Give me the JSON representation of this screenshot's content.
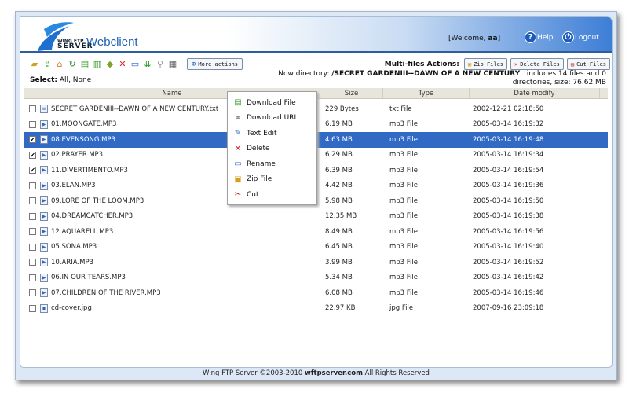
{
  "header": {
    "logo_small": "WING FTP",
    "logo_big": "SERVER",
    "title": "Webclient",
    "welcome_prefix": "[Welcome, ",
    "user": "aa",
    "welcome_suffix": "]",
    "help": "Help",
    "logout": "Logout"
  },
  "toolbar": {
    "icons": [
      "new-folder-icon",
      "upload-icon",
      "home-icon",
      "refresh-icon",
      "download-icon",
      "copy-icon",
      "move-icon",
      "delete-icon",
      "rename-icon",
      "sort-icon",
      "search-icon",
      "view-icon"
    ],
    "more_actions": "More actions"
  },
  "select": {
    "label": "Select:",
    "all": "All",
    "sep": ", ",
    "none": "None"
  },
  "multi": {
    "label": "Multi-files Actions:",
    "zip": "Zip Files",
    "delete": "Delete Files",
    "cut": "Cut Files"
  },
  "dir": {
    "prefix": "Now directory: ",
    "path": "/SECRET GARDENIII--DAWN OF A NEW CENTURY",
    "info1": "includes 14 files and 0",
    "info2": "directories, size: 76.62 MB"
  },
  "columns": {
    "name": "Name",
    "size": "Size",
    "type": "Type",
    "date": "Date modify"
  },
  "files": [
    {
      "name": "SECRET GARDENIII--DAWN OF A NEW CENTURY.txt",
      "size": "229 Bytes",
      "type": "txt File",
      "date": "2002-12-21 02:18:50",
      "checked": false,
      "selected": false
    },
    {
      "name": "01.MOONGATE.MP3",
      "size": "6.19 MB",
      "type": "mp3 File",
      "date": "2005-03-14 16:19:32",
      "checked": false,
      "selected": false
    },
    {
      "name": "08.EVENSONG.MP3",
      "size": "4.63 MB",
      "type": "mp3 File",
      "date": "2005-03-14 16:19:48",
      "checked": true,
      "selected": true
    },
    {
      "name": "02.PRAYER.MP3",
      "size": "6.29 MB",
      "type": "mp3 File",
      "date": "2005-03-14 16:19:34",
      "checked": true,
      "selected": false
    },
    {
      "name": "11.DIVERTIMENTO.MP3",
      "size": "6.39 MB",
      "type": "mp3 File",
      "date": "2005-03-14 16:19:54",
      "checked": true,
      "selected": false
    },
    {
      "name": "03.ELAN.MP3",
      "size": "4.42 MB",
      "type": "mp3 File",
      "date": "2005-03-14 16:19:36",
      "checked": false,
      "selected": false
    },
    {
      "name": "09.LORE OF THE LOOM.MP3",
      "size": "5.98 MB",
      "type": "mp3 File",
      "date": "2005-03-14 16:19:50",
      "checked": false,
      "selected": false
    },
    {
      "name": "04.DREAMCATCHER.MP3",
      "size": "12.35 MB",
      "type": "mp3 File",
      "date": "2005-03-14 16:19:38",
      "checked": false,
      "selected": false
    },
    {
      "name": "12.AQUARELL.MP3",
      "size": "8.49 MB",
      "type": "mp3 File",
      "date": "2005-03-14 16:19:56",
      "checked": false,
      "selected": false
    },
    {
      "name": "05.SONA.MP3",
      "size": "6.45 MB",
      "type": "mp3 File",
      "date": "2005-03-14 16:19:40",
      "checked": false,
      "selected": false
    },
    {
      "name": "10.ARIA.MP3",
      "size": "3.99 MB",
      "type": "mp3 File",
      "date": "2005-03-14 16:19:52",
      "checked": false,
      "selected": false
    },
    {
      "name": "06.IN OUR TEARS.MP3",
      "size": "5.34 MB",
      "type": "mp3 File",
      "date": "2005-03-14 16:19:42",
      "checked": false,
      "selected": false
    },
    {
      "name": "07.CHILDREN OF THE RIVER.MP3",
      "size": "6.08 MB",
      "type": "mp3 File",
      "date": "2005-03-14 16:19:46",
      "checked": false,
      "selected": false
    },
    {
      "name": "cd-cover.jpg",
      "size": "22.97 KB",
      "type": "jpg File",
      "date": "2007-09-16 23:09:18",
      "checked": false,
      "selected": false
    }
  ],
  "context_menu": [
    {
      "label": "Download File",
      "icon": "download-file-icon"
    },
    {
      "label": "Download URL",
      "icon": "link-icon"
    },
    {
      "label": "Text Edit",
      "icon": "edit-icon"
    },
    {
      "label": "Delete",
      "icon": "delete-icon"
    },
    {
      "label": "Rename",
      "icon": "rename-icon"
    },
    {
      "label": "Zip File",
      "icon": "zip-icon"
    },
    {
      "label": "Cut",
      "icon": "cut-icon"
    }
  ],
  "footer": {
    "pre": "Wing FTP Server ©2003-2010 ",
    "site": "wftpserver.com",
    "post": " All Rights Reserved"
  },
  "colors": {
    "accent": "#316ac5",
    "header_blue": "#3d7ed6",
    "frame": "#dce8f6"
  }
}
